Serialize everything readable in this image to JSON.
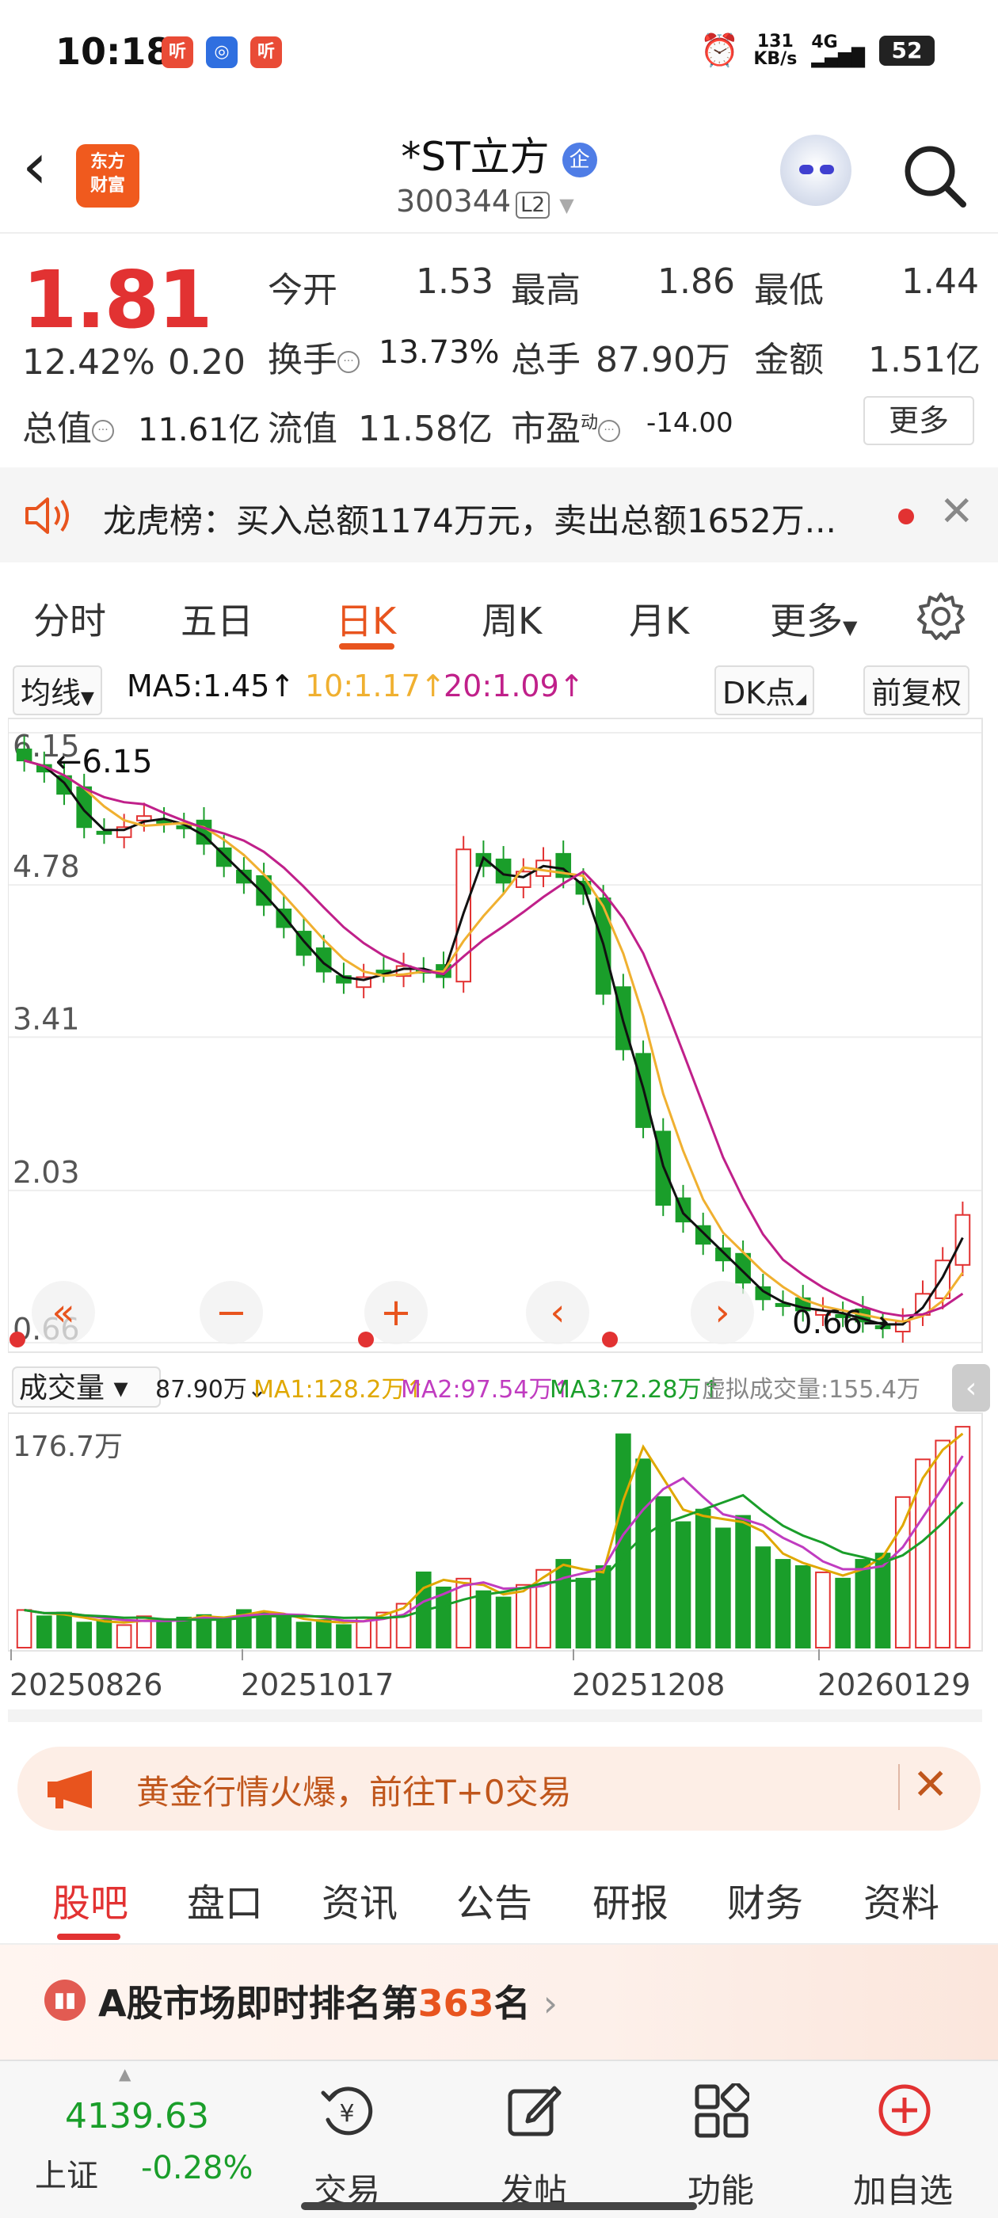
{
  "status_bar": {
    "time": "10:18",
    "app_icon_1": "听",
    "app_icon_3": "听",
    "net_speed_value": "131",
    "net_speed_unit": "KB/s",
    "network": "4G",
    "battery": "52"
  },
  "header": {
    "logo_line1": "东方",
    "logo_line2": "财富",
    "stock_name": "*ST立方",
    "badge": "企",
    "stock_code": "300344",
    "level": "L2"
  },
  "quote": {
    "price": "1.81",
    "change_pct": "12.42%",
    "change_amt": "0.20",
    "open_label": "今开",
    "open_value": "1.53",
    "high_label": "最高",
    "high_value": "1.86",
    "low_label": "最低",
    "low_value": "1.44",
    "turnover_label": "换手",
    "turnover_value": "13.73%",
    "volume_label": "总手",
    "volume_value": "87.90万",
    "amount_label": "金额",
    "amount_value": "1.51亿",
    "mktcap_label": "总值",
    "mktcap_value": "11.61亿",
    "float_label": "流值",
    "float_value": "11.58亿",
    "pe_label": "市盈",
    "pe_sup": "动",
    "pe_value": "-14.00",
    "more_label": "更多"
  },
  "dragon_tiger": {
    "text": "龙虎榜：买入总额1174万元，卖出总额1652万..."
  },
  "chart_tabs": {
    "items": [
      "分时",
      "五日",
      "日K",
      "周K",
      "月K",
      "更多"
    ],
    "active": "日K"
  },
  "ma_bar": {
    "mode": "均线",
    "ma5": "MA5:1.45",
    "ma10": "10:1.17",
    "ma20": "20:1.09",
    "dk": "DK点",
    "adjust": "前复权"
  },
  "volume_bar": {
    "mode": "成交量",
    "vol": "87.90万",
    "ma1": "MA1:128.2万",
    "ma2": "MA2:97.54万",
    "ma3": "MA3:72.28万",
    "virtual": "虚拟成交量:155.4万"
  },
  "chart_data": [
    {
      "type": "candlestick",
      "y_ticks": [
        "6.15",
        "4.78",
        "3.41",
        "2.03",
        "0.66"
      ],
      "ylim": [
        0.66,
        6.15
      ],
      "high_marker": "6.15",
      "low_marker": "0.66",
      "close_values": [
        5.9,
        5.8,
        5.6,
        5.3,
        5.25,
        5.3,
        5.4,
        5.35,
        5.3,
        5.15,
        4.95,
        4.8,
        4.6,
        4.4,
        4.15,
        4.0,
        3.9,
        3.95,
        4.0,
        4.05,
        4.0,
        3.95,
        5.1,
        4.95,
        4.8,
        4.9,
        5.0,
        4.85,
        4.7,
        3.8,
        3.3,
        2.6,
        1.9,
        1.75,
        1.55,
        1.4,
        1.2,
        1.05,
        1.0,
        0.95,
        0.95,
        0.9,
        0.85,
        0.8,
        0.85,
        1.1,
        1.4,
        1.81
      ],
      "ma_series": [
        {
          "name": "MA5",
          "color": "#111111"
        },
        {
          "name": "MA10",
          "color": "#f0b030"
        },
        {
          "name": "MA20",
          "color": "#c0208a"
        }
      ]
    },
    {
      "type": "bar",
      "y_ticks": [
        "176.7万"
      ],
      "ylim": [
        0,
        176.7
      ],
      "x_labels": [
        "20250826",
        "20251017",
        "20251208",
        "20260129"
      ],
      "values": [
        30,
        25,
        28,
        20,
        22,
        18,
        25,
        20,
        24,
        26,
        22,
        30,
        28,
        26,
        20,
        22,
        18,
        24,
        28,
        35,
        60,
        48,
        55,
        45,
        40,
        50,
        62,
        70,
        55,
        65,
        170,
        150,
        120,
        100,
        110,
        95,
        105,
        80,
        70,
        65,
        60,
        55,
        70,
        75,
        120,
        150,
        165,
        176
      ]
    }
  ],
  "promo": {
    "text": "黄金行情火爆，前往T+0交易"
  },
  "bottom_tabs": {
    "items": [
      "股吧",
      "盘口",
      "资讯",
      "公告",
      "研报",
      "财务",
      "资料"
    ],
    "active": "股吧"
  },
  "rank": {
    "prefix": "A股市场即时排名第",
    "number": "363",
    "suffix": "名"
  },
  "bottom_nav": {
    "index_value": "4139.63",
    "index_name": "上证",
    "index_change": "-0.28%",
    "trade": "交易",
    "post": "发帖",
    "func": "功能",
    "add": "加自选",
    "trade_icon_char": "¥"
  },
  "colors": {
    "up": "#e23232",
    "down": "#1a9e2a",
    "accent": "#e8541e"
  }
}
